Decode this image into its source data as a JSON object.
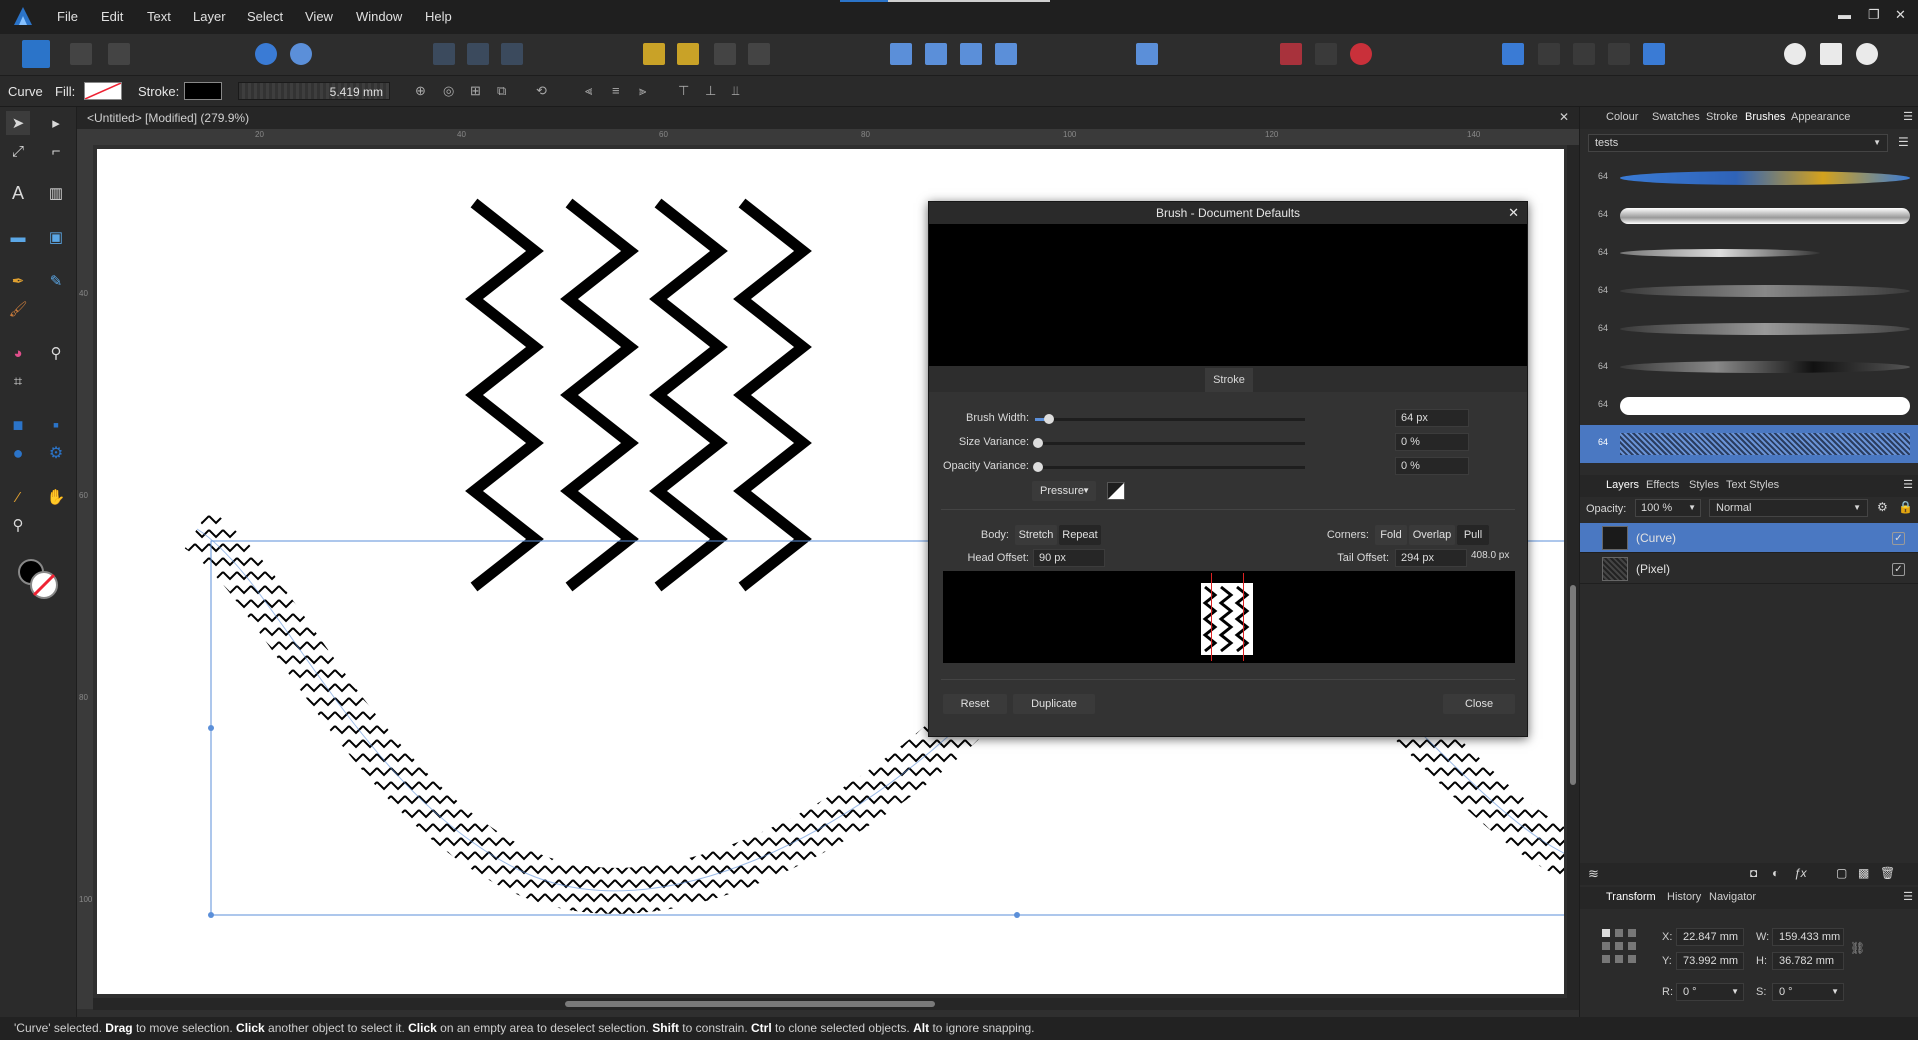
{
  "menubar": {
    "items": [
      "File",
      "Edit",
      "Text",
      "Layer",
      "Select",
      "View",
      "Window",
      "Help"
    ]
  },
  "context": {
    "tool_name": "Curve",
    "fill_label": "Fill:",
    "stroke_label": "Stroke:",
    "stroke_width": "5.419 mm"
  },
  "document": {
    "tab_title": "<Untitled> [Modified] (279.9%)",
    "ruler_h": [
      "20",
      "40",
      "60",
      "80",
      "100",
      "120",
      "140"
    ],
    "ruler_v": [
      "40",
      "60",
      "80",
      "100"
    ]
  },
  "dialog": {
    "title": "Brush - Document Defaults",
    "section_tab": "Stroke",
    "brush_width_label": "Brush Width:",
    "brush_width_value": "64 px",
    "brush_width_fraction": 0.05,
    "size_variance_label": "Size Variance:",
    "size_variance_value": "0 %",
    "opacity_variance_label": "Opacity Variance:",
    "opacity_variance_value": "0 %",
    "pressure_label": "Pressure",
    "body_label": "Body:",
    "body_options": [
      "Stretch",
      "Repeat"
    ],
    "body_selected": "Repeat",
    "corners_label": "Corners:",
    "corner_options": [
      "Fold",
      "Overlap",
      "Pull"
    ],
    "corner_selected": "Pull",
    "head_offset_label": "Head Offset:",
    "head_offset_value": "90 px",
    "tail_offset_label": "Tail Offset:",
    "tail_offset_value": "294 px",
    "total_length": "408.0 px",
    "reset_label": "Reset",
    "duplicate_label": "Duplicate",
    "close_label": "Close"
  },
  "brushes_panel": {
    "tabs": [
      "Colour",
      "Swatches",
      "Stroke",
      "Brushes",
      "Appearance"
    ],
    "active_tab": "Brushes",
    "category": "tests",
    "brush_sizes": [
      "64",
      "64",
      "64",
      "64",
      "64",
      "64",
      "64",
      "64"
    ]
  },
  "layers_panel": {
    "tabs": [
      "Layers",
      "Effects",
      "Styles",
      "Text Styles"
    ],
    "active_tab": "Layers",
    "opacity_label": "Opacity:",
    "opacity_value": "100 %",
    "blend_mode": "Normal",
    "layers": [
      {
        "name": "(Curve)",
        "selected": true,
        "visible_check": "✓"
      },
      {
        "name": "(Pixel)",
        "selected": false,
        "visible_check": "✓"
      }
    ]
  },
  "transform_panel": {
    "tabs": [
      "Transform",
      "History",
      "Navigator"
    ],
    "active_tab": "Transform",
    "x_label": "X:",
    "x_value": "22.847 mm",
    "y_label": "Y:",
    "y_value": "73.992 mm",
    "w_label": "W:",
    "w_value": "159.433 mm",
    "h_label": "H:",
    "h_value": "36.782 mm",
    "r_label": "R:",
    "r_value": "0 °",
    "s_label": "S:",
    "s_value": "0 °"
  },
  "status": {
    "parts": [
      {
        "text": "'Curve' selected. ",
        "bold": false
      },
      {
        "text": "Drag",
        "bold": true
      },
      {
        "text": " to move selection. ",
        "bold": false
      },
      {
        "text": "Click",
        "bold": true
      },
      {
        "text": " another object to select it. ",
        "bold": false
      },
      {
        "text": "Click",
        "bold": true
      },
      {
        "text": " on an empty area to deselect selection. ",
        "bold": false
      },
      {
        "text": "Shift",
        "bold": true
      },
      {
        "text": " to constrain. ",
        "bold": false
      },
      {
        "text": "Ctrl",
        "bold": true
      },
      {
        "text": " to clone selected objects. ",
        "bold": false
      },
      {
        "text": "Alt",
        "bold": true
      },
      {
        "text": " to ignore snapping.",
        "bold": false
      }
    ]
  },
  "colors": {
    "accent": "#4a78c2",
    "selection_blue": "#5b8fd9",
    "panel_bg": "#2b2b2b"
  }
}
